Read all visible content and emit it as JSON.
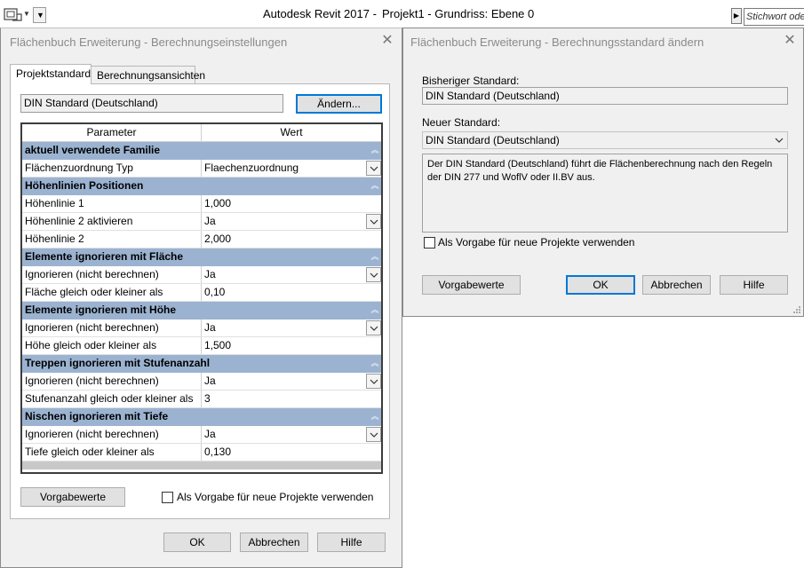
{
  "app": {
    "title": "Autodesk Revit 2017 -",
    "project_title": "Projekt1 - Grundriss: Ebene 0",
    "search_placeholder": "Stichwort ode"
  },
  "dialog_settings": {
    "title": "Flächenbuch Erweiterung - Berechnungseinstellungen",
    "tabs": [
      "Projektstandard",
      "Berechnungsansichten"
    ],
    "standard_value": "DIN Standard (Deutschland)",
    "change_button": "Ändern...",
    "grid": {
      "col_param": "Parameter",
      "col_value": "Wert",
      "groups": [
        {
          "title": "aktuell verwendete Familie",
          "rows": [
            {
              "param": "Flächenzuordnung Typ",
              "value": "Flaechenzuordnung",
              "dropdown": true
            }
          ]
        },
        {
          "title": "Höhenlinien Positionen",
          "rows": [
            {
              "param": "Höhenlinie 1",
              "value": "1,000",
              "dropdown": false
            },
            {
              "param": "Höhenlinie 2 aktivieren",
              "value": "Ja",
              "dropdown": true
            },
            {
              "param": "Höhenlinie 2",
              "value": "2,000",
              "dropdown": false
            }
          ]
        },
        {
          "title": "Elemente ignorieren mit Fläche",
          "rows": [
            {
              "param": "Ignorieren (nicht berechnen)",
              "value": "Ja",
              "dropdown": true
            },
            {
              "param": "Fläche gleich oder kleiner als",
              "value": "0,10",
              "dropdown": false
            }
          ]
        },
        {
          "title": "Elemente ignorieren mit Höhe",
          "rows": [
            {
              "param": "Ignorieren (nicht berechnen)",
              "value": "Ja",
              "dropdown": true
            },
            {
              "param": "Höhe gleich oder kleiner als",
              "value": "1,500",
              "dropdown": false
            }
          ]
        },
        {
          "title": "Treppen ignorieren mit Stufenanzahl",
          "rows": [
            {
              "param": "Ignorieren (nicht berechnen)",
              "value": "Ja",
              "dropdown": true
            },
            {
              "param": "Stufenanzahl gleich oder kleiner als",
              "value": "3",
              "dropdown": false
            }
          ]
        },
        {
          "title": "Nischen ignorieren mit Tiefe",
          "rows": [
            {
              "param": "Ignorieren (nicht berechnen)",
              "value": "Ja",
              "dropdown": true
            },
            {
              "param": "Tiefe gleich oder kleiner als",
              "value": "0,130",
              "dropdown": false
            }
          ]
        }
      ]
    },
    "defaults_button": "Vorgabewerte",
    "default_checkbox_label": "Als Vorgabe für neue Projekte verwenden",
    "ok": "OK",
    "cancel": "Abbrechen",
    "help": "Hilfe"
  },
  "dialog_change": {
    "title": "Flächenbuch Erweiterung - Berechnungsstandard ändern",
    "previous_label": "Bisheriger Standard:",
    "previous_value": "DIN Standard (Deutschland)",
    "new_label": "Neuer Standard:",
    "new_value": "DIN Standard (Deutschland)",
    "description": "Der DIN Standard (Deutschland) führt die Flächenberechnung nach den Regeln der DIN 277 und WoflV oder II.BV aus.",
    "default_checkbox_label": "Als Vorgabe für neue Projekte verwenden",
    "defaults_button": "Vorgabewerte",
    "ok": "OK",
    "cancel": "Abbrechen",
    "help": "Hilfe"
  }
}
